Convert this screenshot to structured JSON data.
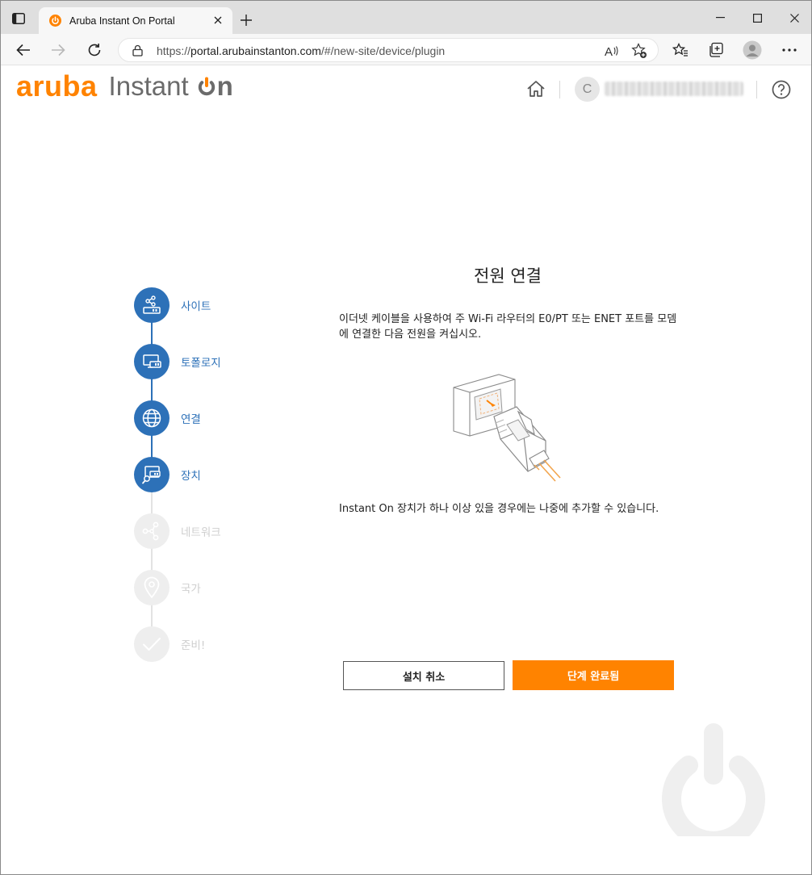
{
  "browser": {
    "tab_title": "Aruba Instant On Portal",
    "url_scheme": "https://",
    "url_host": "portal.arubainstanton.com",
    "url_path": "/#/new-site/device/plugin",
    "icons": {
      "tab_actions": "tab-actions-icon",
      "favicon": "power-icon",
      "close_tab": "close-icon",
      "new_tab": "plus-icon",
      "minimize": "minimize-icon",
      "maximize": "maximize-icon",
      "close_window": "close-icon",
      "back": "back-arrow-icon",
      "forward": "forward-arrow-icon",
      "refresh": "refresh-icon",
      "lock": "lock-icon",
      "read_aloud": "read-aloud-icon",
      "add_favorite": "star-plus-icon",
      "favorites": "favorites-icon",
      "collections": "collections-icon",
      "profile": "profile-icon",
      "more": "more-icon"
    }
  },
  "header": {
    "logo_brand": "aruba",
    "logo_product": "Instant",
    "logo_suffix": "n",
    "user_initial": "C",
    "accent_color": "#ff8300"
  },
  "stepper": {
    "steps": [
      {
        "label": "사이트",
        "state": "done",
        "icon": "site-icon"
      },
      {
        "label": "토폴로지",
        "state": "done",
        "icon": "topology-icon"
      },
      {
        "label": "연결",
        "state": "done",
        "icon": "globe-icon"
      },
      {
        "label": "장치",
        "state": "done",
        "icon": "device-search-icon"
      },
      {
        "label": "네트워크",
        "state": "todo",
        "icon": "network-icon"
      },
      {
        "label": "국가",
        "state": "todo",
        "icon": "location-pin-icon"
      },
      {
        "label": "준비!",
        "state": "todo",
        "icon": "check-icon"
      }
    ],
    "done_color": "#2d71b8",
    "todo_color": "#eeeeee"
  },
  "main": {
    "title": "전원 연결",
    "description": "이더넷 케이블을 사용하여 주 Wi-Fi 라우터의 E0/PT 또는 ENET 포트를 모뎀에 연결한 다음 전원을 켜십시오.",
    "note": "Instant On 장치가 하나 이상 있을 경우에는 나중에 추가할 수 있습니다.",
    "cancel_label": "설치 취소",
    "done_label": "단계 완료됨"
  }
}
